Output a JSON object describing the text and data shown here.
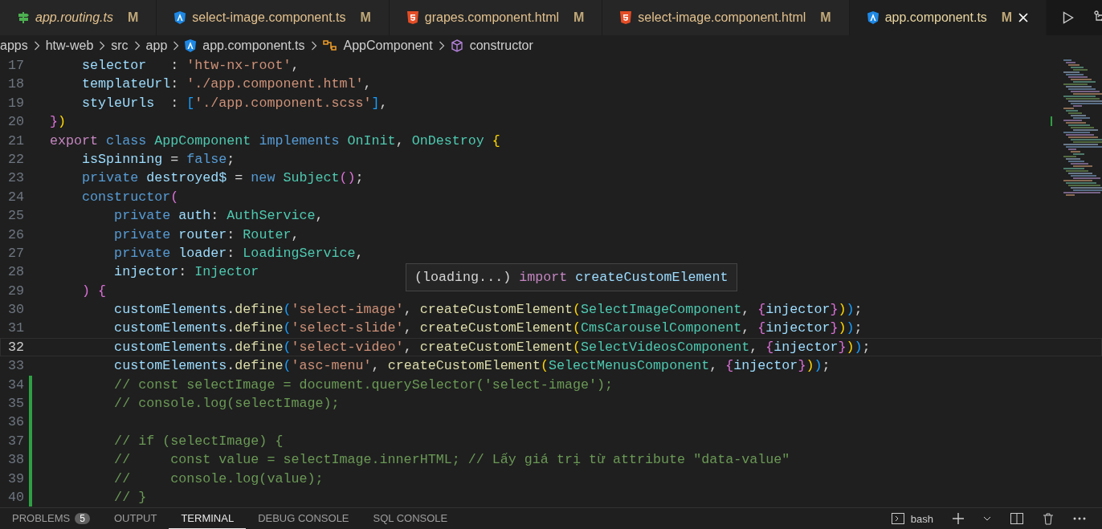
{
  "tabs": [
    {
      "kind": "routing",
      "label": "app.routing.ts",
      "badge": "M",
      "italic": true,
      "selected": false
    },
    {
      "kind": "angular",
      "label": "select-image.component.ts",
      "badge": "M",
      "italic": false,
      "selected": false
    },
    {
      "kind": "html",
      "label": "grapes.component.html",
      "badge": "M",
      "italic": false,
      "selected": false
    },
    {
      "kind": "html",
      "label": "select-image.component.html",
      "badge": "M",
      "italic": false,
      "selected": false
    },
    {
      "kind": "angular",
      "label": "app.component.ts",
      "badge": "M",
      "italic": false,
      "selected": true
    }
  ],
  "breadcrumb": [
    {
      "kind": "folder",
      "label": "apps"
    },
    {
      "kind": "folder",
      "label": "htw-web"
    },
    {
      "kind": "folder",
      "label": "src"
    },
    {
      "kind": "folder",
      "label": "app"
    },
    {
      "kind": "angular",
      "label": "app.component.ts"
    },
    {
      "kind": "class",
      "label": "AppComponent"
    },
    {
      "kind": "method",
      "label": "constructor"
    }
  ],
  "editor": {
    "lines": [
      {
        "number": "17",
        "current": false,
        "changed": false,
        "tokens": [
          {
            "kind": "var",
            "text": "    selector"
          },
          {
            "kind": "p",
            "text": "   : "
          },
          {
            "kind": "str",
            "text": "'htw-nx-root'"
          },
          {
            "kind": "p",
            "text": ","
          }
        ]
      },
      {
        "number": "18",
        "current": false,
        "changed": false,
        "tokens": [
          {
            "kind": "var",
            "text": "    templateUrl"
          },
          {
            "kind": "p",
            "text": ": "
          },
          {
            "kind": "str",
            "text": "'./app.component.html'"
          },
          {
            "kind": "p",
            "text": ","
          }
        ]
      },
      {
        "number": "19",
        "current": false,
        "changed": false,
        "tokens": [
          {
            "kind": "var",
            "text": "    styleUrls"
          },
          {
            "kind": "p",
            "text": "  : "
          },
          {
            "kind": "b3",
            "text": "["
          },
          {
            "kind": "str",
            "text": "'./app.component.scss'"
          },
          {
            "kind": "b3",
            "text": "]"
          },
          {
            "kind": "p",
            "text": ","
          }
        ]
      },
      {
        "number": "20",
        "current": false,
        "changed": false,
        "tokens": [
          {
            "kind": "b2",
            "text": "}"
          },
          {
            "kind": "b1",
            "text": ")"
          }
        ]
      },
      {
        "number": "21",
        "current": false,
        "changed": false,
        "tokens": [
          {
            "kind": "ctl",
            "text": "export"
          },
          {
            "kind": "kw",
            "text": " class"
          },
          {
            "kind": "type",
            "text": " AppComponent"
          },
          {
            "kind": "kw",
            "text": " implements"
          },
          {
            "kind": "type",
            "text": " OnInit"
          },
          {
            "kind": "p",
            "text": ","
          },
          {
            "kind": "type",
            "text": " OnDestroy"
          },
          {
            "kind": "b1",
            "text": " {"
          }
        ]
      },
      {
        "number": "22",
        "current": false,
        "changed": false,
        "tokens": [
          {
            "kind": "var",
            "text": "    isSpinning"
          },
          {
            "kind": "p",
            "text": " = "
          },
          {
            "kind": "kw",
            "text": "false"
          },
          {
            "kind": "p",
            "text": ";"
          }
        ]
      },
      {
        "number": "23",
        "current": false,
        "changed": false,
        "tokens": [
          {
            "kind": "kw",
            "text": "    private"
          },
          {
            "kind": "var",
            "text": " destroyed$"
          },
          {
            "kind": "p",
            "text": " = "
          },
          {
            "kind": "kw",
            "text": "new"
          },
          {
            "kind": "type",
            "text": " Subject"
          },
          {
            "kind": "b2",
            "text": "()"
          },
          {
            "kind": "p",
            "text": ";"
          }
        ]
      },
      {
        "number": "24",
        "current": false,
        "changed": false,
        "tokens": [
          {
            "kind": "kw",
            "text": "    constructor"
          },
          {
            "kind": "b2",
            "text": "("
          }
        ]
      },
      {
        "number": "25",
        "current": false,
        "changed": false,
        "tokens": [
          {
            "kind": "kw",
            "text": "        private"
          },
          {
            "kind": "var",
            "text": " auth"
          },
          {
            "kind": "p",
            "text": ": "
          },
          {
            "kind": "type",
            "text": "AuthService"
          },
          {
            "kind": "p",
            "text": ","
          }
        ]
      },
      {
        "number": "26",
        "current": false,
        "changed": false,
        "tokens": [
          {
            "kind": "kw",
            "text": "        private"
          },
          {
            "kind": "var",
            "text": " router"
          },
          {
            "kind": "p",
            "text": ": "
          },
          {
            "kind": "type",
            "text": "Router"
          },
          {
            "kind": "p",
            "text": ","
          }
        ]
      },
      {
        "number": "27",
        "current": false,
        "changed": false,
        "tokens": [
          {
            "kind": "kw",
            "text": "        private"
          },
          {
            "kind": "var",
            "text": " loader"
          },
          {
            "kind": "p",
            "text": ": "
          },
          {
            "kind": "type",
            "text": "LoadingService"
          },
          {
            "kind": "p",
            "text": ","
          }
        ]
      },
      {
        "number": "28",
        "current": false,
        "changed": false,
        "tokens": [
          {
            "kind": "var",
            "text": "        injector"
          },
          {
            "kind": "p",
            "text": ": "
          },
          {
            "kind": "type",
            "text": "Injector"
          }
        ]
      },
      {
        "number": "29",
        "current": false,
        "changed": false,
        "tokens": [
          {
            "kind": "b2",
            "text": "    )"
          },
          {
            "kind": "b2",
            "text": " {"
          }
        ]
      },
      {
        "number": "30",
        "current": false,
        "changed": false,
        "tokens": [
          {
            "kind": "var",
            "text": "        customElements"
          },
          {
            "kind": "p",
            "text": "."
          },
          {
            "kind": "fn",
            "text": "define"
          },
          {
            "kind": "b3",
            "text": "("
          },
          {
            "kind": "str",
            "text": "'select-image'"
          },
          {
            "kind": "p",
            "text": ", "
          },
          {
            "kind": "fn",
            "text": "createCustomElement"
          },
          {
            "kind": "b1",
            "text": "("
          },
          {
            "kind": "type",
            "text": "SelectImageComponent"
          },
          {
            "kind": "p",
            "text": ", "
          },
          {
            "kind": "b2",
            "text": "{"
          },
          {
            "kind": "var",
            "text": "injector"
          },
          {
            "kind": "b2",
            "text": "}"
          },
          {
            "kind": "b1",
            "text": ")"
          },
          {
            "kind": "b3",
            "text": ")"
          },
          {
            "kind": "p",
            "text": ";"
          }
        ]
      },
      {
        "number": "31",
        "current": false,
        "changed": false,
        "tokens": [
          {
            "kind": "var",
            "text": "        customElements"
          },
          {
            "kind": "p",
            "text": "."
          },
          {
            "kind": "fn",
            "text": "define"
          },
          {
            "kind": "b3",
            "text": "("
          },
          {
            "kind": "str",
            "text": "'select-slide'"
          },
          {
            "kind": "p",
            "text": ", "
          },
          {
            "kind": "fn",
            "text": "createCustomElement"
          },
          {
            "kind": "b1",
            "text": "("
          },
          {
            "kind": "type",
            "text": "CmsCarouselComponent"
          },
          {
            "kind": "p",
            "text": ", "
          },
          {
            "kind": "b2",
            "text": "{"
          },
          {
            "kind": "var",
            "text": "injector"
          },
          {
            "kind": "b2",
            "text": "}"
          },
          {
            "kind": "b1",
            "text": ")"
          },
          {
            "kind": "b3",
            "text": ")"
          },
          {
            "kind": "p",
            "text": ";"
          }
        ]
      },
      {
        "number": "32",
        "current": true,
        "changed": false,
        "tokens": [
          {
            "kind": "var",
            "text": "        customElements"
          },
          {
            "kind": "p",
            "text": "."
          },
          {
            "kind": "fn",
            "text": "define"
          },
          {
            "kind": "b3",
            "text": "("
          },
          {
            "kind": "str",
            "text": "'select-video'"
          },
          {
            "kind": "p",
            "text": ", "
          },
          {
            "kind": "fn",
            "text": "createCustomElement"
          },
          {
            "kind": "b1",
            "text": "("
          },
          {
            "kind": "type",
            "text": "SelectVideosComponent"
          },
          {
            "kind": "p",
            "text": ", "
          },
          {
            "kind": "b2",
            "text": "{"
          },
          {
            "kind": "var",
            "text": "injector"
          },
          {
            "kind": "b2",
            "text": "}"
          },
          {
            "kind": "b1",
            "text": ")"
          },
          {
            "kind": "b3",
            "text": ")"
          },
          {
            "kind": "p",
            "text": ";"
          }
        ]
      },
      {
        "number": "33",
        "current": false,
        "changed": false,
        "tokens": [
          {
            "kind": "var",
            "text": "        customElements"
          },
          {
            "kind": "p",
            "text": "."
          },
          {
            "kind": "fn",
            "text": "define"
          },
          {
            "kind": "b3",
            "text": "("
          },
          {
            "kind": "str",
            "text": "'asc-menu'"
          },
          {
            "kind": "p",
            "text": ", "
          },
          {
            "kind": "fn",
            "text": "createCustomElement"
          },
          {
            "kind": "b1",
            "text": "("
          },
          {
            "kind": "type",
            "text": "SelectMenusComponent"
          },
          {
            "kind": "p",
            "text": ", "
          },
          {
            "kind": "b2",
            "text": "{"
          },
          {
            "kind": "var",
            "text": "injector"
          },
          {
            "kind": "b2",
            "text": "}"
          },
          {
            "kind": "b1",
            "text": ")"
          },
          {
            "kind": "b3",
            "text": ")"
          },
          {
            "kind": "p",
            "text": ";"
          }
        ]
      },
      {
        "number": "34",
        "current": false,
        "changed": true,
        "tokens": [
          {
            "kind": "com",
            "text": "        // const selectImage = document.querySelector('select-image');"
          }
        ]
      },
      {
        "number": "35",
        "current": false,
        "changed": true,
        "tokens": [
          {
            "kind": "com",
            "text": "        // console.log(selectImage);"
          }
        ]
      },
      {
        "number": "36",
        "current": false,
        "changed": true
      },
      {
        "number": "37",
        "current": false,
        "changed": true,
        "tokens": [
          {
            "kind": "com",
            "text": "        // if (selectImage) {"
          }
        ]
      },
      {
        "number": "38",
        "current": false,
        "changed": true,
        "tokens": [
          {
            "kind": "com",
            "text": "        //     const value = selectImage.innerHTML; // Lấy giá trị từ attribute \"data-value\""
          }
        ]
      },
      {
        "number": "39",
        "current": false,
        "changed": true,
        "tokens": [
          {
            "kind": "com",
            "text": "        //     console.log(value);"
          }
        ]
      },
      {
        "number": "40",
        "current": false,
        "changed": true,
        "tokens": [
          {
            "kind": "com",
            "text": "        // }"
          }
        ]
      }
    ],
    "hover": {
      "tokens": [
        {
          "kind": "p",
          "text": "(loading...)"
        },
        {
          "kind": "ctl",
          "text": "import"
        },
        {
          "kind": "var",
          "text": "createCustomElement"
        }
      ]
    }
  },
  "panel": {
    "tabs": [
      {
        "label": "PROBLEMS",
        "count": "5",
        "selected": false
      },
      {
        "label": "OUTPUT",
        "selected": false
      },
      {
        "label": "TERMINAL",
        "selected": true
      },
      {
        "label": "DEBUG CONSOLE",
        "selected": false
      },
      {
        "label": "SQL CONSOLE",
        "selected": false
      }
    ],
    "shell": "bash"
  }
}
